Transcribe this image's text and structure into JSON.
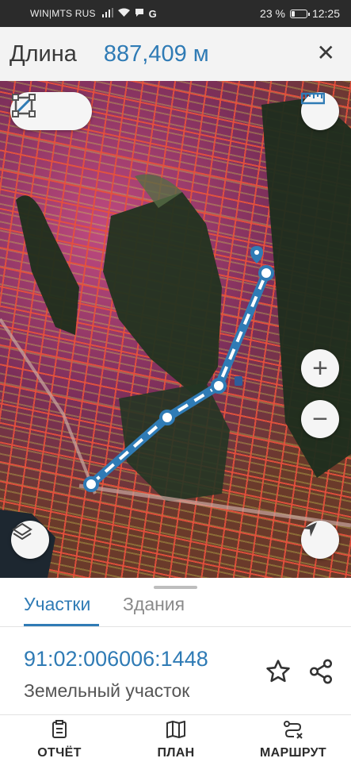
{
  "status_bar": {
    "carrier": "WIN|MTS RUS",
    "signal_text": "..ıl",
    "battery_percent": "23 %",
    "battery_level": 0.23,
    "time": "12:25"
  },
  "header": {
    "title": "Длина",
    "length_value": "887,409 м",
    "close_icon": "close-icon"
  },
  "map": {
    "tools": [
      "polyline-measure-icon",
      "area-measure-icon"
    ],
    "ruler_icon": "ruler-icon",
    "zoom_in": "+",
    "zoom_out": "−",
    "layers_icon": "layers-icon",
    "location_icon": "navigation-arrow-icon",
    "route_color": "#2f7bb5"
  },
  "tabs": {
    "active": "Участки",
    "inactive": "Здания"
  },
  "parcel": {
    "cadastral_number": "91:02:006006:1448",
    "type": "Земельный участок",
    "favorite_icon": "star-icon",
    "share_icon": "share-icon"
  },
  "bottom_nav": {
    "report": "ОТЧЁТ",
    "plan": "ПЛАН",
    "route": "МАРШРУТ"
  }
}
